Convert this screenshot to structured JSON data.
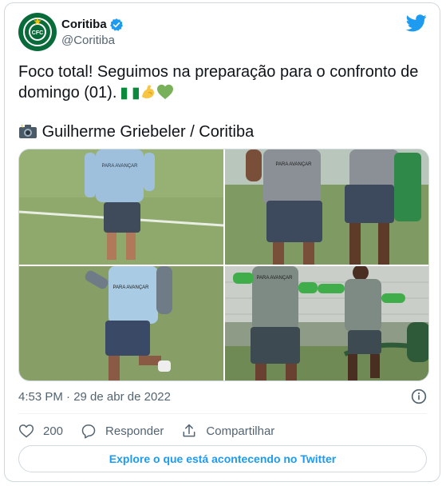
{
  "author": {
    "display_name": "Coritiba",
    "handle": "@Coritiba",
    "avatar_text": "CFC"
  },
  "tweet": {
    "text": "Foco total! Seguimos na preparação para o confronto de domingo (01).",
    "caption": "Guilherme Griebeler / Coritiba"
  },
  "photos": [
    {
      "label": "PARA AVANÇAR"
    },
    {
      "label": "PARA AVANÇAR"
    },
    {
      "label": "PARA AVANÇAR"
    },
    {
      "label": "PARA AVANÇAR"
    }
  ],
  "timestamp": "4:53 PM · 29 de abr de 2022",
  "actions": {
    "likes": "200",
    "reply_label": "Responder",
    "share_label": "Compartilhar"
  },
  "explore_label": "Explore o que está acontecendo no Twitter",
  "colors": {
    "accent": "#1d9bf0",
    "brand": "#0a6b3a",
    "verified": "#1d9bf0"
  }
}
